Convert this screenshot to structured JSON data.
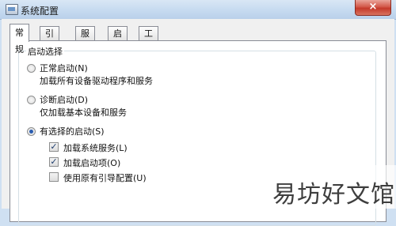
{
  "window": {
    "title": "系统配置",
    "close_glyph": "×"
  },
  "tabs": [
    {
      "label": "常规",
      "active": true
    },
    {
      "label": "引导",
      "active": false
    },
    {
      "label": "服务",
      "active": false
    },
    {
      "label": "启动",
      "active": false
    },
    {
      "label": "工具",
      "active": false
    }
  ],
  "startup_group": {
    "legend": "启动选择",
    "options": [
      {
        "label": "正常启动(N)",
        "description": "加载所有设备驱动程序和服务",
        "selected": false
      },
      {
        "label": "诊断启动(D)",
        "description": "仅加载基本设备和服务",
        "selected": false
      },
      {
        "label": "有选择的启动(S)",
        "selected": true
      }
    ],
    "selective_items": [
      {
        "label": "加载系统服务(L)",
        "checked": true
      },
      {
        "label": "加载启动项(O)",
        "checked": true
      },
      {
        "label": "使用原有引导配置(U)",
        "checked": false
      }
    ]
  },
  "watermark": {
    "text": "易坊好文馆"
  },
  "check_glyph": "✓"
}
